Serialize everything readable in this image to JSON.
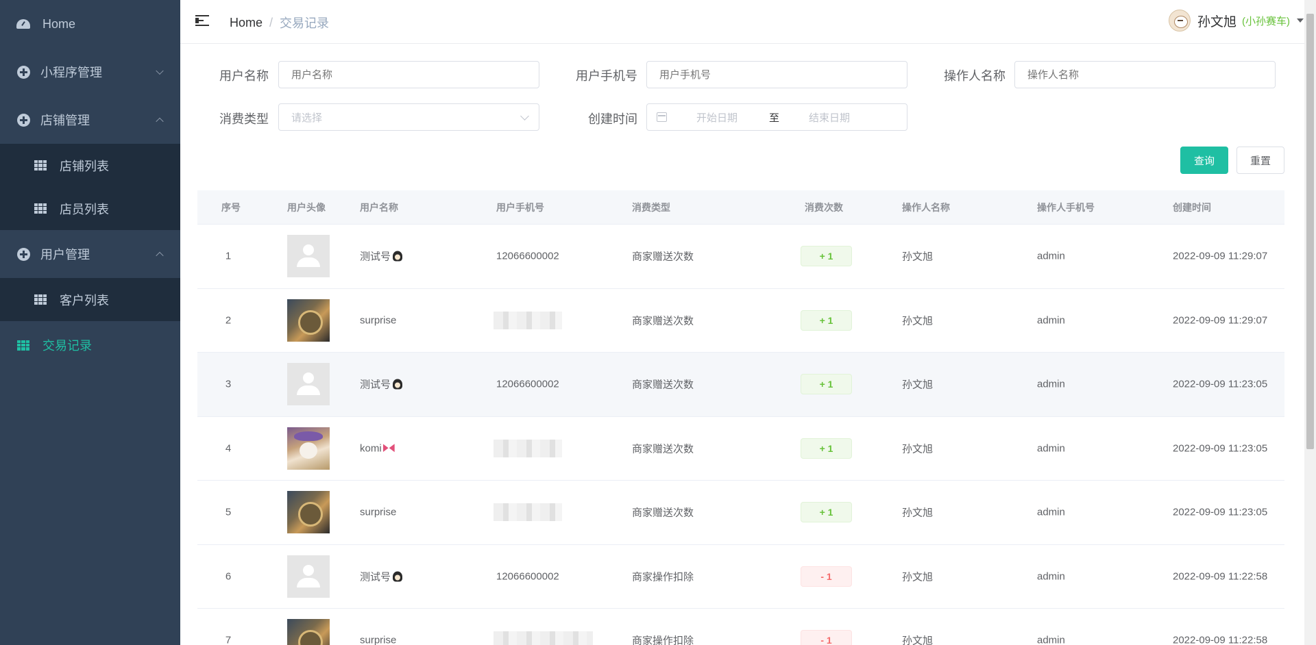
{
  "sidebar": {
    "home": "Home",
    "miniprogram": "小程序管理",
    "store": "店铺管理",
    "store_list": "店铺列表",
    "staff_list": "店员列表",
    "user": "用户管理",
    "customer_list": "客户列表",
    "transactions": "交易记录"
  },
  "header": {
    "breadcrumb_home": "Home",
    "breadcrumb_sep": "/",
    "breadcrumb_current": "交易记录",
    "user_name": "孙文旭",
    "user_shop": "(小孙赛车)"
  },
  "filters": {
    "username_label": "用户名称",
    "username_placeholder": "用户名称",
    "phone_label": "用户手机号",
    "phone_placeholder": "用户手机号",
    "operator_label": "操作人名称",
    "operator_placeholder": "操作人名称",
    "type_label": "消费类型",
    "type_placeholder": "请选择",
    "time_label": "创建时间",
    "start_placeholder": "开始日期",
    "range_sep": "至",
    "end_placeholder": "结束日期",
    "search_button": "查询",
    "reset_button": "重置"
  },
  "table": {
    "columns": [
      "序号",
      "用户头像",
      "用户名称",
      "用户手机号",
      "消费类型",
      "消费次数",
      "操作人名称",
      "操作人手机号",
      "创建时间"
    ],
    "rows": [
      {
        "index": "1",
        "avatar": "default",
        "name": "测试号",
        "emoji": "penguin",
        "phone": "12066600002",
        "phone_masked": false,
        "type": "商家赠送次数",
        "count": "+ 1",
        "count_kind": "plus",
        "operator": "孙文旭",
        "operator_phone": "admin",
        "created": "2022-09-09 11:29:07"
      },
      {
        "index": "2",
        "avatar": "photo-coin",
        "name": "surprise",
        "emoji": "",
        "phone": "",
        "phone_masked": true,
        "type": "商家赠送次数",
        "count": "+ 1",
        "count_kind": "plus",
        "operator": "孙文旭",
        "operator_phone": "admin",
        "created": "2022-09-09 11:29:07"
      },
      {
        "index": "3",
        "avatar": "default",
        "name": "测试号",
        "emoji": "penguin",
        "phone": "12066600002",
        "phone_masked": false,
        "type": "商家赠送次数",
        "count": "+ 1",
        "count_kind": "plus",
        "operator": "孙文旭",
        "operator_phone": "admin",
        "created": "2022-09-09 11:23:05"
      },
      {
        "index": "4",
        "avatar": "photo-cat",
        "name": "komi",
        "emoji": "bow",
        "phone": "",
        "phone_masked": true,
        "type": "商家赠送次数",
        "count": "+ 1",
        "count_kind": "plus",
        "operator": "孙文旭",
        "operator_phone": "admin",
        "created": "2022-09-09 11:23:05"
      },
      {
        "index": "5",
        "avatar": "photo-coin",
        "name": "surprise",
        "emoji": "",
        "phone": "",
        "phone_masked": true,
        "type": "商家赠送次数",
        "count": "+ 1",
        "count_kind": "plus",
        "operator": "孙文旭",
        "operator_phone": "admin",
        "created": "2022-09-09 11:23:05"
      },
      {
        "index": "6",
        "avatar": "default",
        "name": "测试号",
        "emoji": "penguin",
        "phone": "12066600002",
        "phone_masked": false,
        "type": "商家操作扣除",
        "count": "- 1",
        "count_kind": "minus",
        "operator": "孙文旭",
        "operator_phone": "admin",
        "created": "2022-09-09 11:22:58"
      },
      {
        "index": "7",
        "avatar": "photo-coin",
        "name": "surprise",
        "emoji": "",
        "phone": "",
        "phone_masked": true,
        "type": "商家操作扣除",
        "count": "- 1",
        "count_kind": "minus",
        "operator": "孙文旭",
        "operator_phone": "admin",
        "created": "2022-09-09 11:22:58"
      }
    ]
  },
  "colors": {
    "sidebar_bg": "#304156",
    "submenu_bg": "#1f2d3d",
    "accent": "#1fbfa3",
    "plus_text": "#67c23a",
    "minus_text": "#f56c6c"
  }
}
